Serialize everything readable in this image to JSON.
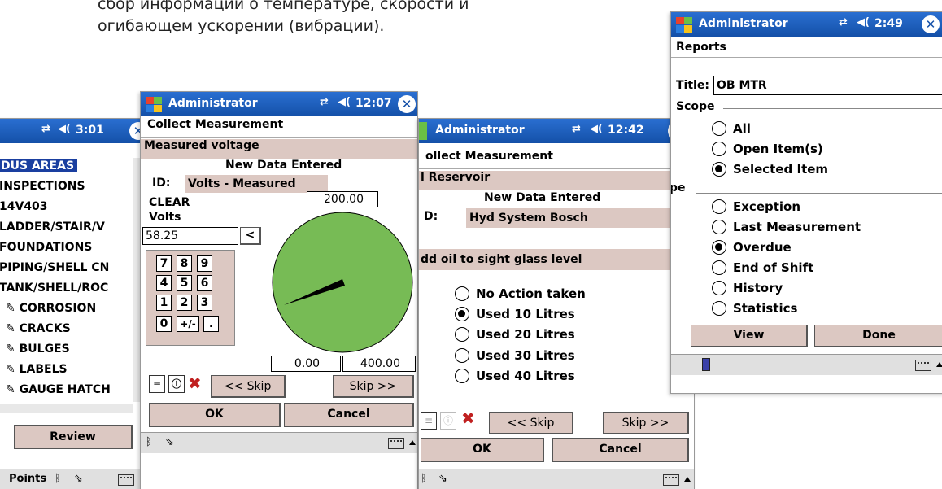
{
  "caption": {
    "line1": "сбор информации о температуре, скорости и",
    "line2": "огибающем ускорении (вибрации)."
  },
  "window1": {
    "clock": "3:01",
    "list_items": [
      "DUS AREAS",
      "INSPECTIONS",
      "14V403",
      "LADDER/STAIR/V",
      "FOUNDATIONS",
      "PIPING/SHELL CN",
      "TANK/SHELL/ROC",
      "CORROSION",
      "CRACKS",
      "BULGES",
      "LABELS",
      "GAUGE HATCH"
    ],
    "review_button": "Review",
    "bottom_label": "Points"
  },
  "window2": {
    "app_title": "Administrator",
    "clock": "12:07",
    "subtitle": "Collect Measurement",
    "point_name": "Measured voltage",
    "status": "New Data Entered",
    "id_label": "ID:",
    "id_value": "Volts - Measured",
    "clear_label": "CLEAR",
    "unit_label": "Volts",
    "value_input": "58.25",
    "backspace": "<",
    "keys": [
      "7",
      "8",
      "9",
      "4",
      "5",
      "6",
      "1",
      "2",
      "3",
      "0",
      "+/-",
      "."
    ],
    "gauge_max_label": "200.00",
    "gauge_min": "0.00",
    "gauge_alarm": "400.00",
    "skip_prev": "<< Skip",
    "skip_next": "Skip >>",
    "ok": "OK",
    "cancel": "Cancel",
    "gauge_color": "#77bb55"
  },
  "window3": {
    "app_title": "Administrator",
    "clock": "12:42",
    "subtitle": "ollect Measurement",
    "point_name": "l Reservoir",
    "status": "New Data Entered",
    "id_label": "D:",
    "id_value": "Hyd System Bosch",
    "instruction": "dd oil to sight glass level",
    "options": [
      {
        "label": "No Action taken",
        "selected": false
      },
      {
        "label": "Used 10 Litres",
        "selected": true
      },
      {
        "label": "Used 20 Litres",
        "selected": false
      },
      {
        "label": "Used 30 Litres",
        "selected": false
      },
      {
        "label": "Used 40 Litres",
        "selected": false
      }
    ],
    "skip_prev": "<< Skip",
    "skip_next": "Skip >>",
    "ok": "OK",
    "cancel": "Cancel"
  },
  "window4": {
    "app_title": "Administrator",
    "clock": "2:49",
    "subtitle": "Reports",
    "title_label": "Title:",
    "title_value": "OB MTR",
    "scope_label": "Scope",
    "scope_options": [
      {
        "label": "All",
        "selected": false
      },
      {
        "label": "Open Item(s)",
        "selected": false
      },
      {
        "label": "Selected Item",
        "selected": true
      }
    ],
    "type_label": "pe",
    "type_options": [
      {
        "label": "Exception",
        "selected": false
      },
      {
        "label": "Last Measurement",
        "selected": false
      },
      {
        "label": "Overdue",
        "selected": true
      },
      {
        "label": "End of Shift",
        "selected": false
      },
      {
        "label": "History",
        "selected": false
      },
      {
        "label": "Statistics",
        "selected": false
      }
    ],
    "view": "View",
    "done": "Done"
  },
  "colors": {
    "titlebar": "#1a5cbc",
    "field_bg": "#dcc8c2",
    "gauge": "#77bb55"
  }
}
